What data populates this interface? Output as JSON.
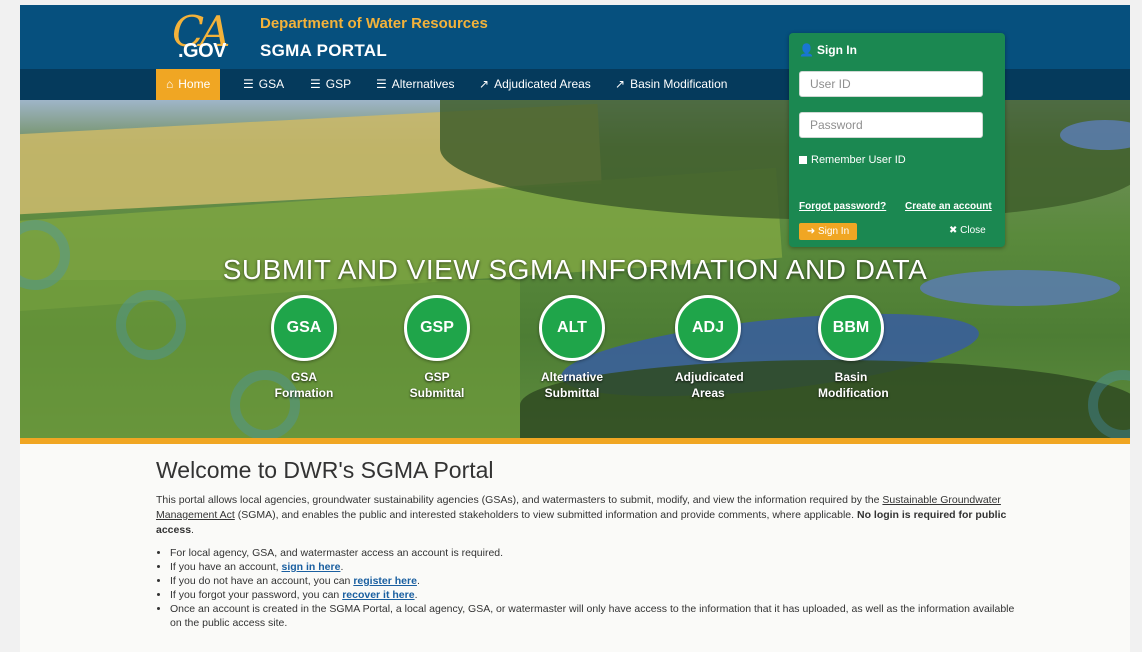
{
  "header": {
    "logo_ca": "CA",
    "logo_gov": ".GOV",
    "department": "Department of Water Resources",
    "portal": "SGMA PORTAL"
  },
  "nav": {
    "items": [
      {
        "label": "Home",
        "icon": "home-icon"
      },
      {
        "label": "GSA",
        "icon": "list-icon"
      },
      {
        "label": "GSP",
        "icon": "list-icon"
      },
      {
        "label": "Alternatives",
        "icon": "list-icon"
      },
      {
        "label": "Adjudicated Areas",
        "icon": "external-link-icon"
      },
      {
        "label": "Basin Modification",
        "icon": "external-link-icon"
      }
    ]
  },
  "hero": {
    "title": "SUBMIT AND VIEW SGMA INFORMATION AND DATA",
    "buttons": [
      {
        "abbr": "GSA",
        "line1": "GSA",
        "line2": "Formation"
      },
      {
        "abbr": "GSP",
        "line1": "GSP",
        "line2": "Submittal"
      },
      {
        "abbr": "ALT",
        "line1": "Alternative",
        "line2": "Submittal"
      },
      {
        "abbr": "ADJ",
        "line1": "Adjudicated",
        "line2": "Areas"
      },
      {
        "abbr": "BBM",
        "line1": "Basin",
        "line2": "Modification"
      }
    ]
  },
  "signin": {
    "title": "Sign In",
    "user_placeholder": "User ID",
    "password_placeholder": "Password",
    "remember_label": "Remember User ID",
    "forgot": "Forgot password?",
    "create": "Create an account",
    "submit": "Sign In",
    "close": "Close"
  },
  "content": {
    "welcome": "Welcome to DWR's SGMA Portal",
    "intro_part1": "This portal allows local agencies, groundwater sustainability agencies (GSAs), and watermasters to submit, modify, and view the information required by the",
    "intro_link": "Sustainable Groundwater Management Act",
    "intro_part2": "(SGMA), and enables the public and interested stakeholders to view submitted information and provide comments, where applicable.",
    "intro_bold": "No login is required for public access",
    "intro_end": ".",
    "bullet1": "For local agency, GSA, and watermaster access an account is required.",
    "bullet2_pre": "If you have an account,",
    "bullet2_link": "sign in here",
    "bullet3_pre": "If you do not have an account, you can",
    "bullet3_link": "register here",
    "bullet4_pre": "If you forgot your password, you can",
    "bullet4_link": "recover it here",
    "period": ".",
    "bullet5": "Once an account is created in the SGMA Portal, a local agency, GSA, or watermaster will only have access to the information that it has uploaded, as well as the information available on the public access site."
  }
}
